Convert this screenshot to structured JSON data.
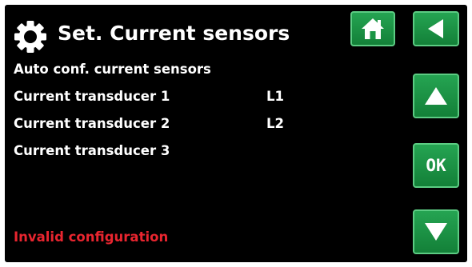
{
  "header": {
    "title": "Set. Current sensors",
    "icon": "gear-icon"
  },
  "menu": {
    "items": [
      {
        "label": "Auto conf. current sensors",
        "value": ""
      },
      {
        "label": "Current transducer 1",
        "value": "L1"
      },
      {
        "label": "Current transducer 2",
        "value": "L2"
      },
      {
        "label": "Current transducer 3",
        "value": ""
      }
    ]
  },
  "status": {
    "text": "Invalid configuration",
    "color": "#e8252f"
  },
  "buttons": {
    "home_icon": "home-icon",
    "back_icon": "back-arrow-icon",
    "up_icon": "up-arrow-icon",
    "ok_label": "OK",
    "down_icon": "down-arrow-icon"
  },
  "colors": {
    "background": "#000000",
    "button_green": "#1a9645",
    "button_border": "#5ccc83",
    "text": "#ffffff"
  }
}
